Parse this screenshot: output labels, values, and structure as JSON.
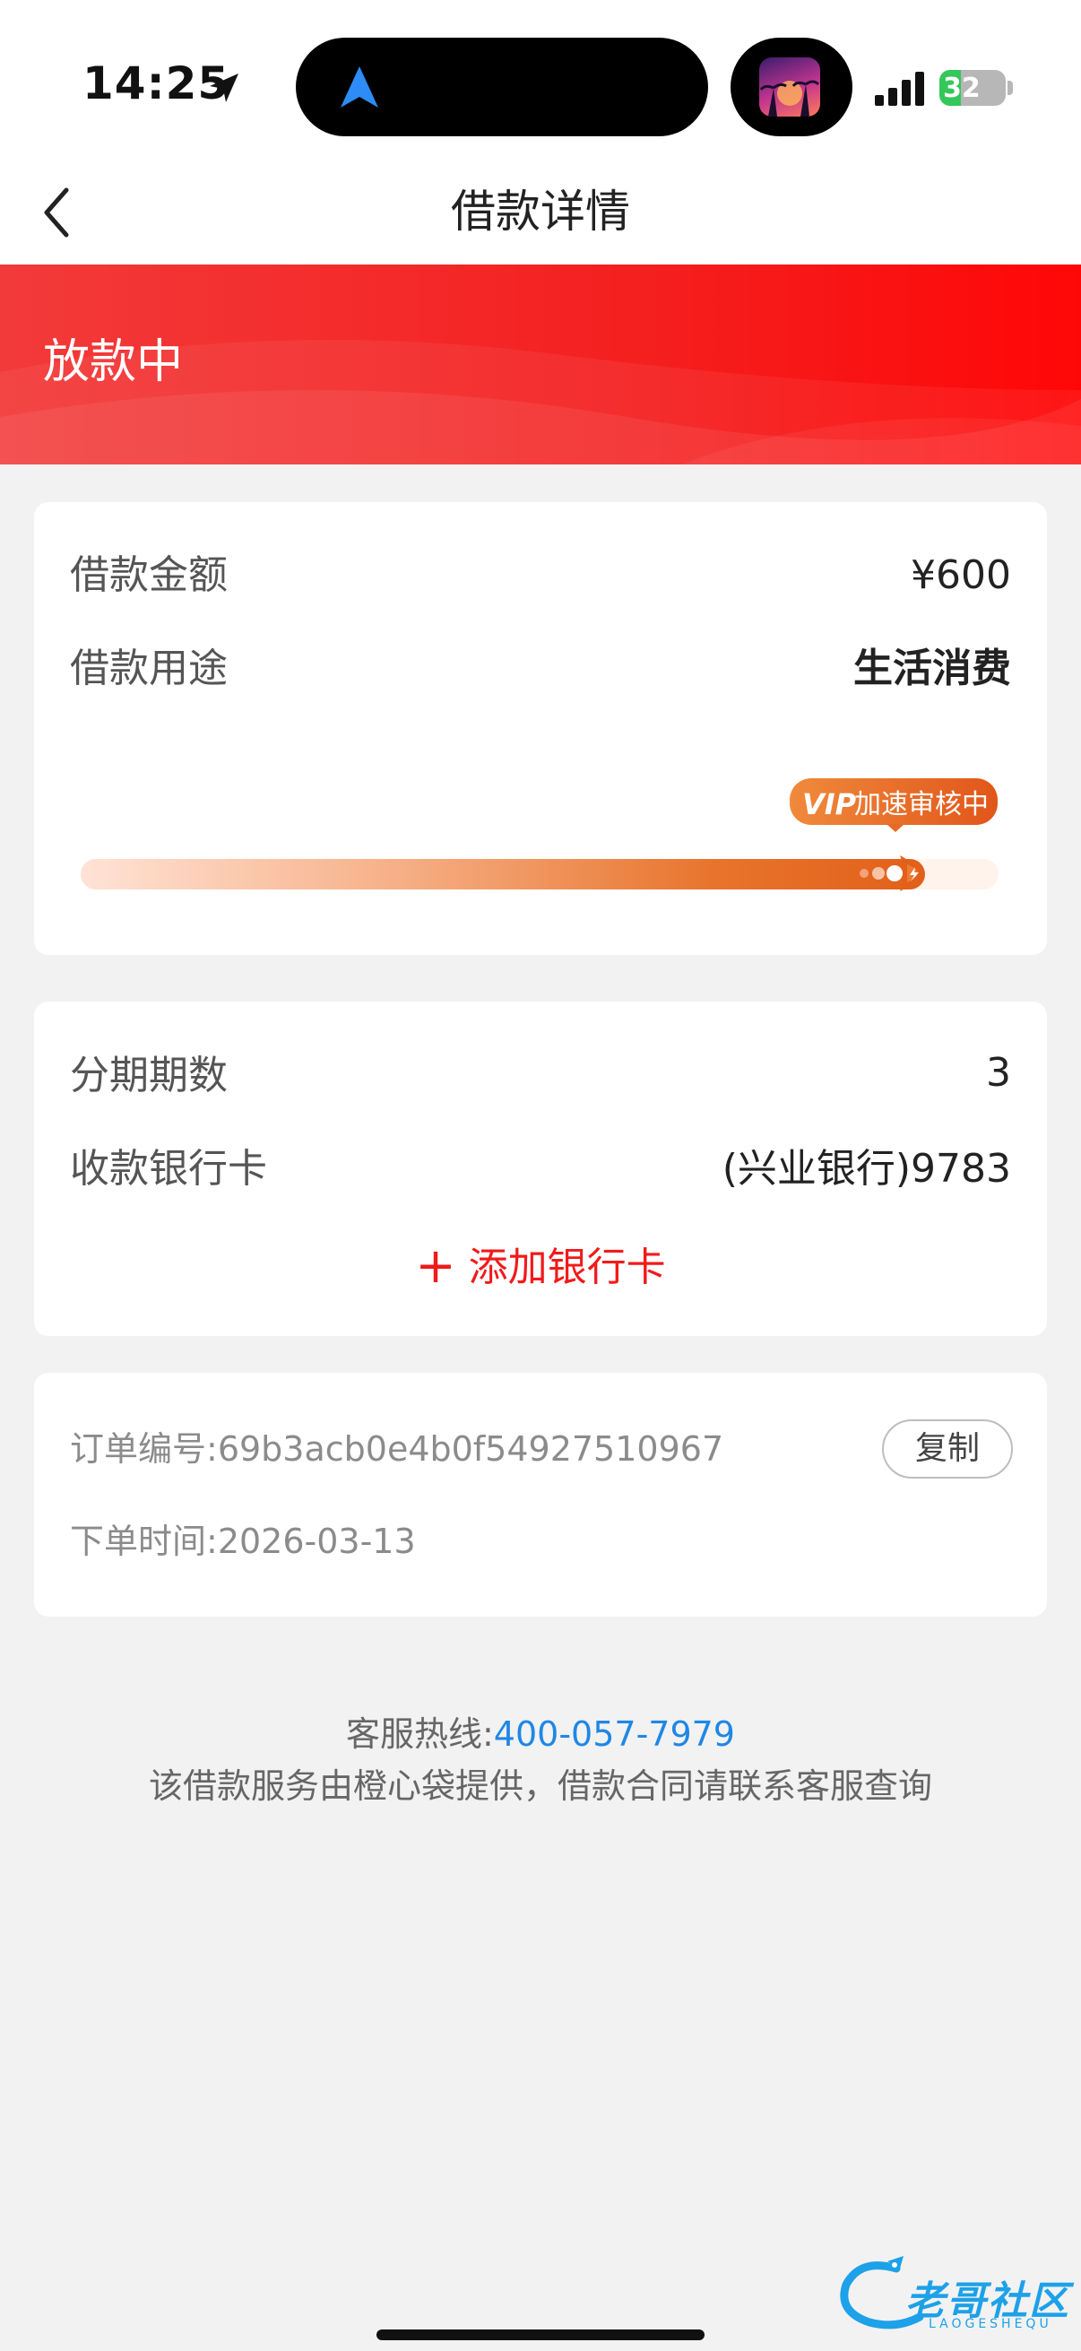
{
  "status_bar": {
    "time": "14:25",
    "battery": "32",
    "battery_level": 0.32
  },
  "nav": {
    "title": "借款详情"
  },
  "hero": {
    "status": "放款中"
  },
  "loan": {
    "amount_label": "借款金额",
    "amount_value": "¥600",
    "purpose_label": "借款用途",
    "purpose_value": "生活消费",
    "vip_logo": "VIP",
    "vip_badge": "加速审核中",
    "progress": 0.92
  },
  "installment": {
    "periods_label": "分期期数",
    "periods_value": "3",
    "bank_label": "收款银行卡",
    "bank_value": "(兴业银行)9783",
    "add_card_label": "添加银行卡"
  },
  "order": {
    "number_label": "订单编号:",
    "number_value": "69b3acb0e4b0f54927510967",
    "copy_label": "复制",
    "time_label": "下单时间:",
    "time_value": "2026-03-13"
  },
  "footer": {
    "hotline_label": "客服热线:",
    "hotline_number": "400-057-7979",
    "notice": "该借款服务由橙心袋提供，借款合同请联系客服查询"
  },
  "watermark": {
    "text": "老哥社区",
    "sub": "LAOGESHEQU"
  },
  "colors": {
    "brand_red": "#f41f1f",
    "progress_orange": "#e2601a",
    "link_blue": "#1f87e5"
  }
}
